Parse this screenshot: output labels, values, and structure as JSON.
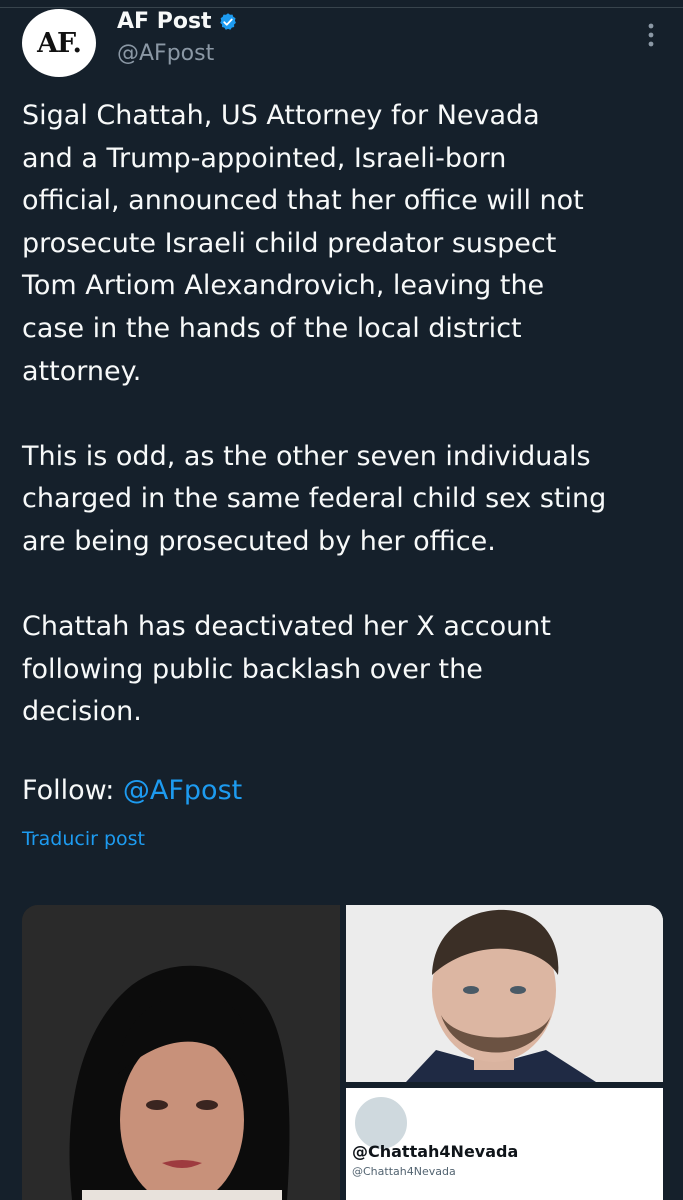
{
  "author": {
    "avatar_text": "AF.",
    "name": "AF Post",
    "handle": "@AFpost",
    "verified": true
  },
  "post": {
    "text": "Sigal Chattah, US Attorney for Nevada\nand a Trump-appointed, Israeli-born\nofficial, announced that her office will not\nprosecute Israeli child predator suspect\nTom Artiom Alexandrovich, leaving the\ncase in the hands of the local district\nattorney.\n\nThis is odd, as the other seven individuals\ncharged in the same federal child sex sting\nare being prosecuted by her office.\n\nChattah has deactivated her X account\nfollowing public backlash over the\ndecision.",
    "follow_label": "Follow: ",
    "follow_handle": "@AFpost",
    "translate_label": "Traducir post"
  },
  "media": {
    "card_name": "@Chattah4Nevada",
    "card_handle": "@Chattah4Nevada"
  },
  "icons": {
    "verified": "verified-badge-icon",
    "more": "more-options-icon"
  },
  "colors": {
    "background": "#15202b",
    "accent": "#1d9bf0",
    "secondary_text": "#8b98a5"
  }
}
